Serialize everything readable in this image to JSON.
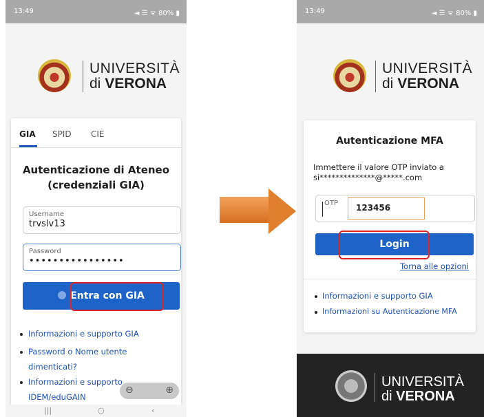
{
  "left": {
    "status": {
      "time": "13:49",
      "icons": "◄ ☰ ᯤ 80% ▮"
    },
    "logo": {
      "line1": "UNIVERSITÀ",
      "line2_prefix": "di ",
      "line2_bold": "VERONA"
    },
    "tabs": [
      "GIA",
      "SPID",
      "CIE"
    ],
    "title_line1": "Autenticazione di Ateneo",
    "title_line2": "(credenziali GIA)",
    "username": {
      "label": "Username",
      "value": "trvslv13"
    },
    "password": {
      "label": "Password",
      "value": "••••••••••••••••"
    },
    "login_button": "Entra con GIA",
    "links": [
      "Informazioni e supporto GIA",
      "Password o Nome utente",
      "dimenticati?",
      "Informazioni e supporto",
      "IDEM/eduGAIN"
    ],
    "zoom": {
      "out": "⊖",
      "in": "⊕"
    },
    "nav": {
      "recent": "|||",
      "home": "○",
      "back": "‹"
    }
  },
  "right": {
    "status": {
      "time": "13:49",
      "icons": "◄ ☰ ᯤ 80% ▮"
    },
    "logo": {
      "line1": "UNIVERSITÀ",
      "line2_prefix": "di ",
      "line2_bold": "VERONA"
    },
    "title": "Autenticazione MFA",
    "instruction_line1": "Immettere il valore OTP inviato a",
    "instruction_line2": "si**************@*****.com",
    "otp": {
      "label": "OTP",
      "value": "123456"
    },
    "login_button": "Login",
    "back_link": "Torna alle opzioni",
    "links": [
      "Informazioni e supporto GIA",
      "Informazioni su Autenticazione MFA"
    ],
    "footer_logo": {
      "line1": "UNIVERSITÀ",
      "line2_prefix": "di ",
      "line2_bold": "VERONA"
    }
  },
  "colors": {
    "primary_button": "#1e64c8",
    "highlight": "#d9262c",
    "arrow": "#e07f2e",
    "link": "#1d4fb0"
  }
}
